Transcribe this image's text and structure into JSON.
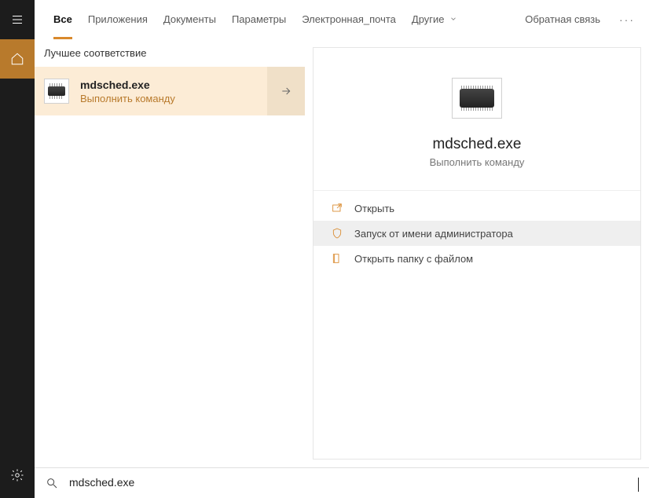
{
  "tabs": {
    "all": "Все",
    "apps": "Приложения",
    "docs": "Документы",
    "settings": "Параметры",
    "email": "Электронная_почта",
    "more": "Другие",
    "feedback": "Обратная связь"
  },
  "left": {
    "best_match_header": "Лучшее соответствие",
    "result_title": "mdsched.exe",
    "result_subtitle": "Выполнить команду"
  },
  "detail": {
    "title": "mdsched.exe",
    "subtitle": "Выполнить команду",
    "actions": {
      "open": "Открыть",
      "run_admin": "Запуск от имени администратора",
      "open_folder": "Открыть папку с файлом"
    }
  },
  "search": {
    "value": "mdsched.exe"
  }
}
